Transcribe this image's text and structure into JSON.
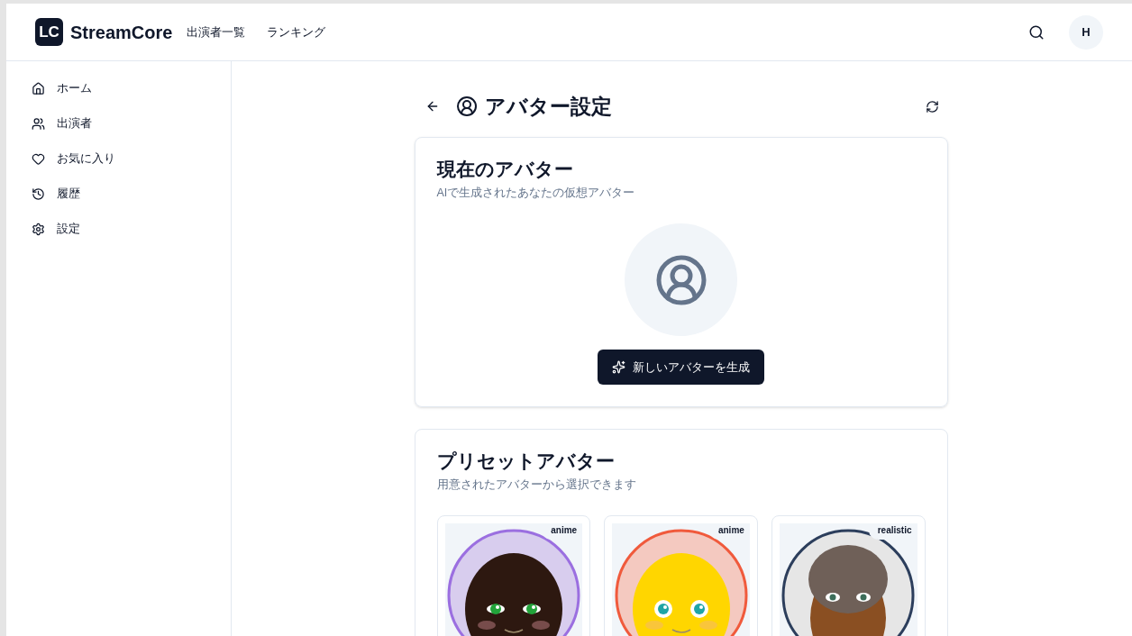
{
  "header": {
    "logo_mark": "LC",
    "brand": "StreamCore",
    "nav": [
      "出演者一覧",
      "ランキング"
    ],
    "user_initial": "H"
  },
  "sidebar": {
    "items": [
      {
        "label": "ホーム",
        "kind": "home"
      },
      {
        "label": "出演者",
        "kind": "users"
      },
      {
        "label": "お気に入り",
        "kind": "heart"
      },
      {
        "label": "履歴",
        "kind": "history"
      },
      {
        "label": "設定",
        "kind": "settings"
      }
    ]
  },
  "page": {
    "title": "アバター設定"
  },
  "current_avatar": {
    "title": "現在のアバター",
    "subtitle": "AIで生成されたあなたの仮想アバター",
    "generate_button": "新しいアバターを生成"
  },
  "presets": {
    "title": "プリセットアバター",
    "subtitle": "用意されたアバターから選択できます",
    "items": [
      {
        "tag": "anime",
        "kind": "anime",
        "color": "#9b6fe0"
      },
      {
        "tag": "anime",
        "kind": "anime",
        "color": "#f05a3c"
      },
      {
        "tag": "realistic",
        "kind": "realistic",
        "color": "#2c3e5c"
      }
    ]
  }
}
